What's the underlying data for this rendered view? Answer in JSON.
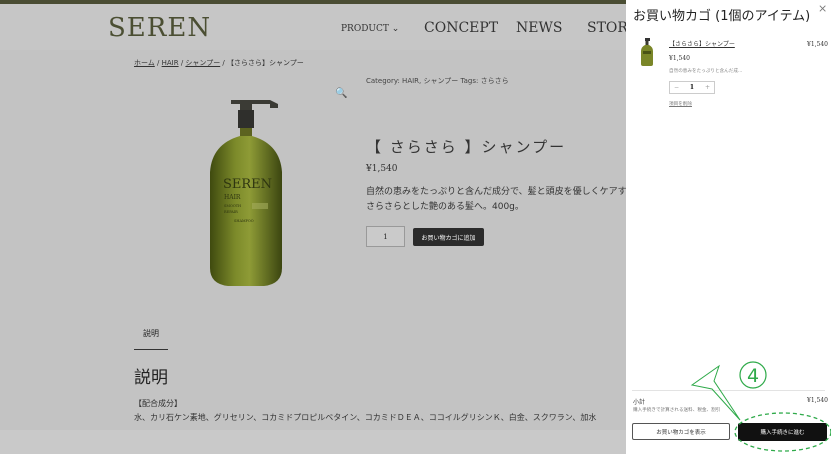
{
  "header": {
    "logo": "SEREN",
    "nav": [
      "PRODUCT ⌄",
      "CONCEPT",
      "NEWS",
      "STORE"
    ]
  },
  "breadcrumb": {
    "home": "ホーム",
    "hair": "HAIR",
    "shampoo": "シャンプー",
    "current": "【さらさら】シャンプー",
    "sep": " / "
  },
  "product": {
    "meta": "Category: HAIR, シャンプー   Tags: さらさら",
    "title": "【 さらさら 】シャンプー",
    "price": "¥1,540",
    "desc_line1": "自然の恵みをたっぷりと含んだ成分で、髪と頭皮を優しくケアす",
    "desc_line2": "さらさらとした艶のある髪へ。400g。",
    "qty": "1",
    "add_to_cart": "お買い物カゴに追加",
    "bottle_label": [
      "SEREN",
      "HAIR",
      "SMOOTH",
      "REPAIR",
      "SHAMPOO"
    ]
  },
  "tabs": {
    "description": "説明"
  },
  "description": {
    "heading": "説明",
    "ingredients_label": "【配合成分】",
    "ingredients": "水、カリ石ケン素地、グリセリン、コカミドプロピルベタイン、コカミドＤＥＡ、ココイルグリシンＫ、白金、スクワラン、加水"
  },
  "cart": {
    "title": "お買い物カゴ (1個のアイテム)",
    "close": "×",
    "item": {
      "name": "【さらさら】シャンプー",
      "price": "¥1,540",
      "line_total": "¥1,540",
      "desc": "自然の恵みをたっぷりと含んだ成...",
      "qty": "1",
      "minus": "−",
      "plus": "+",
      "remove": "項目を削除"
    },
    "subtotal_label": "小計",
    "subtotal_value": "¥1,540",
    "note": "購入手続きで計算される送料、税金、割引",
    "view_cart": "お買い物カゴを表示",
    "checkout": "購入手続きに進む"
  },
  "annotation": {
    "step": "4",
    "color": "#2faa4a"
  }
}
